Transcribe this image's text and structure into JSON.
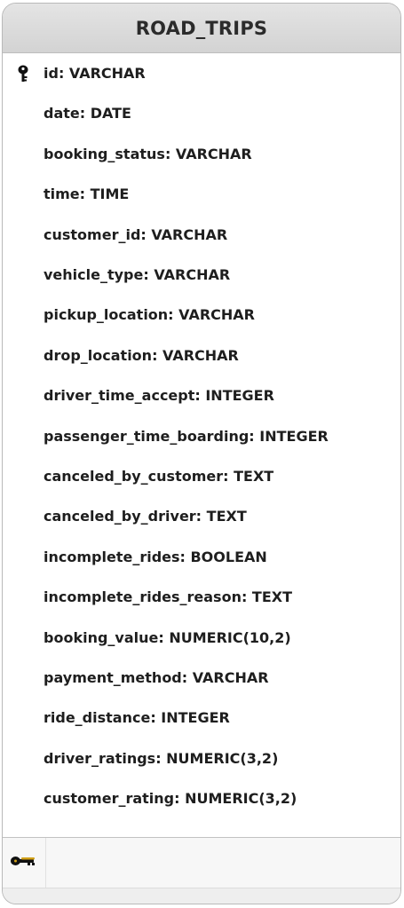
{
  "table": {
    "title": "ROAD_TRIPS",
    "primary_key_icon": "primary-key-icon",
    "foreign_key_icon": "foreign-key-icon",
    "columns": [
      {
        "text": "id: VARCHAR",
        "is_primary_key": true
      },
      {
        "text": "date: DATE",
        "is_primary_key": false
      },
      {
        "text": "booking_status: VARCHAR",
        "is_primary_key": false
      },
      {
        "text": "time: TIME",
        "is_primary_key": false
      },
      {
        "text": "customer_id: VARCHAR",
        "is_primary_key": false
      },
      {
        "text": "vehicle_type: VARCHAR",
        "is_primary_key": false
      },
      {
        "text": "pickup_location: VARCHAR",
        "is_primary_key": false
      },
      {
        "text": "drop_location: VARCHAR",
        "is_primary_key": false
      },
      {
        "text": "driver_time_accept: INTEGER",
        "is_primary_key": false
      },
      {
        "text": "passenger_time_boarding: INTEGER",
        "is_primary_key": false
      },
      {
        "text": "canceled_by_customer: TEXT",
        "is_primary_key": false
      },
      {
        "text": "canceled_by_driver: TEXT",
        "is_primary_key": false
      },
      {
        "text": "incomplete_rides: BOOLEAN",
        "is_primary_key": false
      },
      {
        "text": "incomplete_rides_reason: TEXT",
        "is_primary_key": false
      },
      {
        "text": "booking_value: NUMERIC(10,2)",
        "is_primary_key": false
      },
      {
        "text": "payment_method: VARCHAR",
        "is_primary_key": false
      },
      {
        "text": "ride_distance: INTEGER",
        "is_primary_key": false
      },
      {
        "text": "driver_ratings: NUMERIC(3,2)",
        "is_primary_key": false
      },
      {
        "text": "customer_rating: NUMERIC(3,2)",
        "is_primary_key": false
      }
    ]
  },
  "colors": {
    "header_bg": "#d9d9d9",
    "body_bg": "#ffffff",
    "text": "#1e1e1e",
    "primary_key_icon": "#111111",
    "foreign_key_icon": "#c89a12"
  }
}
